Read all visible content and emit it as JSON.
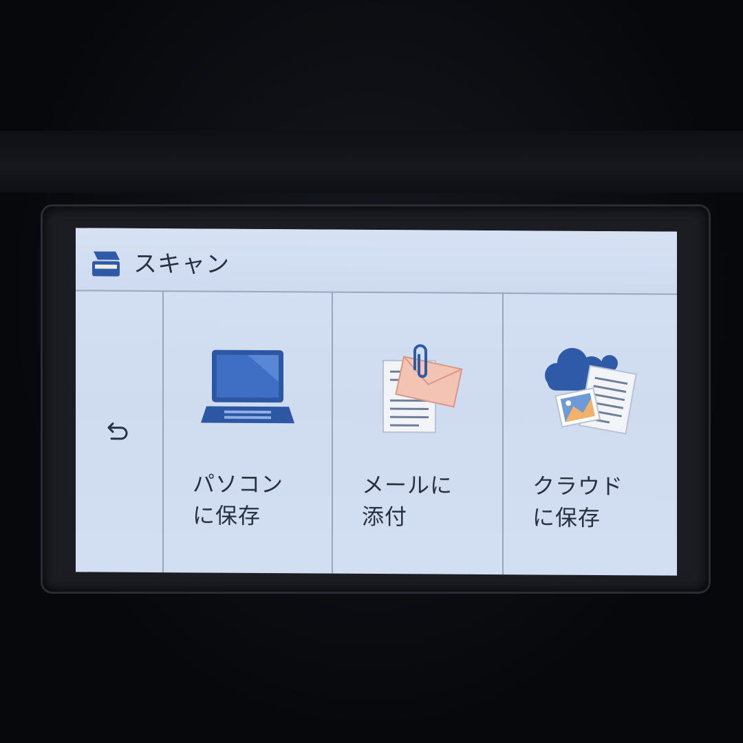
{
  "header": {
    "title": "スキャン",
    "icon": "scanner-icon"
  },
  "back": {
    "icon": "back-arrow-icon"
  },
  "options": [
    {
      "line1": "パソコン",
      "line2": "に保存",
      "icon": "laptop-icon"
    },
    {
      "line1": "メールに",
      "line2": "添付",
      "icon": "mail-attachment-icon"
    },
    {
      "line1": "クラウド",
      "line2": "に保存",
      "icon": "cloud-save-icon"
    }
  ],
  "colors": {
    "screen_bg": "#d2def1",
    "accent_blue": "#2f5aa8",
    "text": "#27313f",
    "divider": "#98a6bc"
  }
}
